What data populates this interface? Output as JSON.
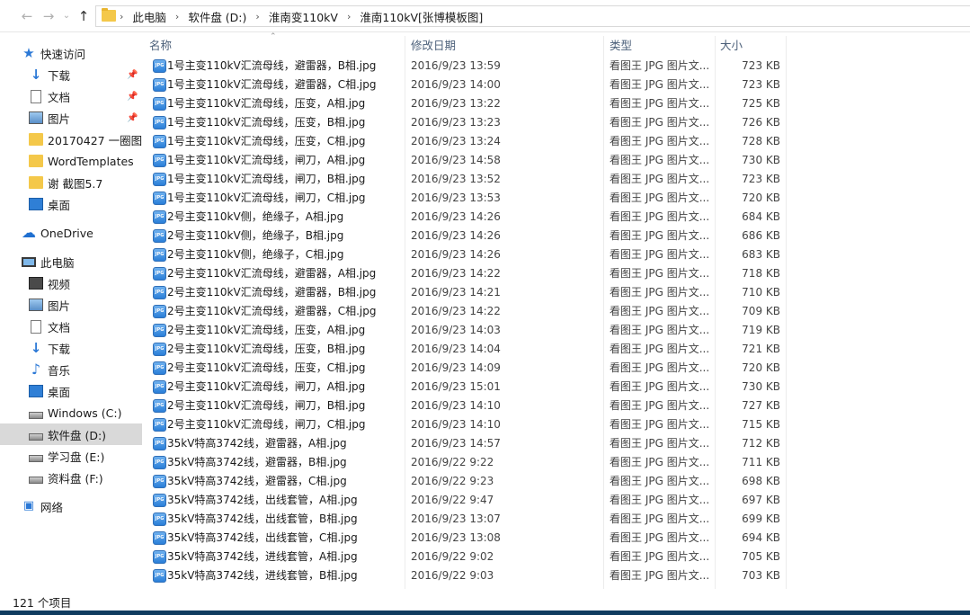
{
  "address": {
    "crumbs": [
      "此电脑",
      "软件盘 (D:)",
      "淮南变110kV",
      "淮南110kV[张博模板图]"
    ]
  },
  "sidebar": {
    "quick_access": "快速访问",
    "items": [
      {
        "label": "下载",
        "icon": "download-icon",
        "pinned": true
      },
      {
        "label": "文档",
        "icon": "document-icon",
        "pinned": true
      },
      {
        "label": "图片",
        "icon": "picture-icon",
        "pinned": true
      },
      {
        "label": "20170427 一圈图",
        "icon": "folder-icon"
      },
      {
        "label": "WordTemplates",
        "icon": "folder-icon"
      },
      {
        "label": "谢 截图5.7",
        "icon": "folder-icon"
      },
      {
        "label": "桌面",
        "icon": "desktop-icon"
      }
    ],
    "onedrive": "OneDrive",
    "this_pc": "此电脑",
    "pc_items": [
      {
        "label": "视频",
        "icon": "video-icon"
      },
      {
        "label": "图片",
        "icon": "picture-icon"
      },
      {
        "label": "文档",
        "icon": "document-icon"
      },
      {
        "label": "下载",
        "icon": "download-icon"
      },
      {
        "label": "音乐",
        "icon": "music-icon"
      },
      {
        "label": "桌面",
        "icon": "desktop-icon"
      },
      {
        "label": "Windows (C:)",
        "icon": "drive-icon"
      },
      {
        "label": "软件盘 (D:)",
        "icon": "drive-icon",
        "selected": true
      },
      {
        "label": "学习盘 (E:)",
        "icon": "drive-icon"
      },
      {
        "label": "资料盘 (F:)",
        "icon": "drive-icon"
      }
    ],
    "network": "网络"
  },
  "columns": {
    "name": "名称",
    "date": "修改日期",
    "type": "类型",
    "size": "大小"
  },
  "files": [
    {
      "name": "1号主变110kV汇流母线，避雷器，B相.jpg",
      "date": "2016/9/23 13:59",
      "type": "看图王 JPG 图片文...",
      "size": "723 KB"
    },
    {
      "name": "1号主变110kV汇流母线，避雷器，C相.jpg",
      "date": "2016/9/23 14:00",
      "type": "看图王 JPG 图片文...",
      "size": "723 KB"
    },
    {
      "name": "1号主变110kV汇流母线，压变，A相.jpg",
      "date": "2016/9/23 13:22",
      "type": "看图王 JPG 图片文...",
      "size": "725 KB"
    },
    {
      "name": "1号主变110kV汇流母线，压变，B相.jpg",
      "date": "2016/9/23 13:23",
      "type": "看图王 JPG 图片文...",
      "size": "726 KB"
    },
    {
      "name": "1号主变110kV汇流母线，压变，C相.jpg",
      "date": "2016/9/23 13:24",
      "type": "看图王 JPG 图片文...",
      "size": "728 KB"
    },
    {
      "name": "1号主变110kV汇流母线，闸刀，A相.jpg",
      "date": "2016/9/23 14:58",
      "type": "看图王 JPG 图片文...",
      "size": "730 KB"
    },
    {
      "name": "1号主变110kV汇流母线，闸刀，B相.jpg",
      "date": "2016/9/23 13:52",
      "type": "看图王 JPG 图片文...",
      "size": "723 KB"
    },
    {
      "name": "1号主变110kV汇流母线，闸刀，C相.jpg",
      "date": "2016/9/23 13:53",
      "type": "看图王 JPG 图片文...",
      "size": "720 KB"
    },
    {
      "name": "2号主变110kV侧，绝缘子，A相.jpg",
      "date": "2016/9/23 14:26",
      "type": "看图王 JPG 图片文...",
      "size": "684 KB"
    },
    {
      "name": "2号主变110kV侧，绝缘子，B相.jpg",
      "date": "2016/9/23 14:26",
      "type": "看图王 JPG 图片文...",
      "size": "686 KB"
    },
    {
      "name": "2号主变110kV侧，绝缘子，C相.jpg",
      "date": "2016/9/23 14:26",
      "type": "看图王 JPG 图片文...",
      "size": "683 KB"
    },
    {
      "name": "2号主变110kV汇流母线，避雷器，A相.jpg",
      "date": "2016/9/23 14:22",
      "type": "看图王 JPG 图片文...",
      "size": "718 KB"
    },
    {
      "name": "2号主变110kV汇流母线，避雷器，B相.jpg",
      "date": "2016/9/23 14:21",
      "type": "看图王 JPG 图片文...",
      "size": "710 KB"
    },
    {
      "name": "2号主变110kV汇流母线，避雷器，C相.jpg",
      "date": "2016/9/23 14:22",
      "type": "看图王 JPG 图片文...",
      "size": "709 KB"
    },
    {
      "name": "2号主变110kV汇流母线，压变，A相.jpg",
      "date": "2016/9/23 14:03",
      "type": "看图王 JPG 图片文...",
      "size": "719 KB"
    },
    {
      "name": "2号主变110kV汇流母线，压变，B相.jpg",
      "date": "2016/9/23 14:04",
      "type": "看图王 JPG 图片文...",
      "size": "721 KB"
    },
    {
      "name": "2号主变110kV汇流母线，压变，C相.jpg",
      "date": "2016/9/23 14:09",
      "type": "看图王 JPG 图片文...",
      "size": "720 KB"
    },
    {
      "name": "2号主变110kV汇流母线，闸刀，A相.jpg",
      "date": "2016/9/23 15:01",
      "type": "看图王 JPG 图片文...",
      "size": "730 KB"
    },
    {
      "name": "2号主变110kV汇流母线，闸刀，B相.jpg",
      "date": "2016/9/23 14:10",
      "type": "看图王 JPG 图片文...",
      "size": "727 KB"
    },
    {
      "name": "2号主变110kV汇流母线，闸刀，C相.jpg",
      "date": "2016/9/23 14:10",
      "type": "看图王 JPG 图片文...",
      "size": "715 KB"
    },
    {
      "name": "35kV特高3742线，避雷器，A相.jpg",
      "date": "2016/9/23 14:57",
      "type": "看图王 JPG 图片文...",
      "size": "712 KB"
    },
    {
      "name": "35kV特高3742线，避雷器，B相.jpg",
      "date": "2016/9/22 9:22",
      "type": "看图王 JPG 图片文...",
      "size": "711 KB"
    },
    {
      "name": "35kV特高3742线，避雷器，C相.jpg",
      "date": "2016/9/22 9:23",
      "type": "看图王 JPG 图片文...",
      "size": "698 KB"
    },
    {
      "name": "35kV特高3742线，出线套管，A相.jpg",
      "date": "2016/9/22 9:47",
      "type": "看图王 JPG 图片文...",
      "size": "697 KB"
    },
    {
      "name": "35kV特高3742线，出线套管，B相.jpg",
      "date": "2016/9/23 13:07",
      "type": "看图王 JPG 图片文...",
      "size": "699 KB"
    },
    {
      "name": "35kV特高3742线，出线套管，C相.jpg",
      "date": "2016/9/23 13:08",
      "type": "看图王 JPG 图片文...",
      "size": "694 KB"
    },
    {
      "name": "35kV特高3742线，进线套管，A相.jpg",
      "date": "2016/9/22 9:02",
      "type": "看图王 JPG 图片文...",
      "size": "705 KB"
    },
    {
      "name": "35kV特高3742线，进线套管，B相.jpg",
      "date": "2016/9/22 9:03",
      "type": "看图王 JPG 图片文...",
      "size": "703 KB"
    }
  ],
  "status": {
    "item_count": "121 个项目"
  }
}
